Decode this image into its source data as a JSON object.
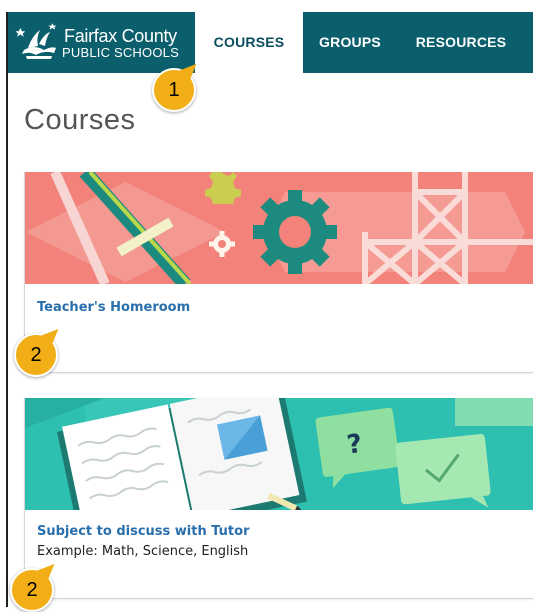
{
  "header": {
    "logo": {
      "line1": "Fairfax County",
      "line2": "PUBLIC SCHOOLS"
    },
    "tabs": [
      {
        "label": "COURSES",
        "active": true
      },
      {
        "label": "GROUPS",
        "active": false
      },
      {
        "label": "RESOURCES",
        "active": false
      }
    ]
  },
  "page": {
    "title": "Courses"
  },
  "courses": [
    {
      "title": "Teacher's Homeroom",
      "description": ""
    },
    {
      "title": "Subject to discuss with Tutor",
      "description": "Example: Math, Science, English"
    }
  ],
  "callouts": [
    "1",
    "2",
    "2"
  ],
  "colors": {
    "nav_bg": "#0b5f6c",
    "link": "#2a6fad",
    "callout": "#f1ae17",
    "banner1": "#f2827a",
    "banner2": "#2dbfb0"
  }
}
